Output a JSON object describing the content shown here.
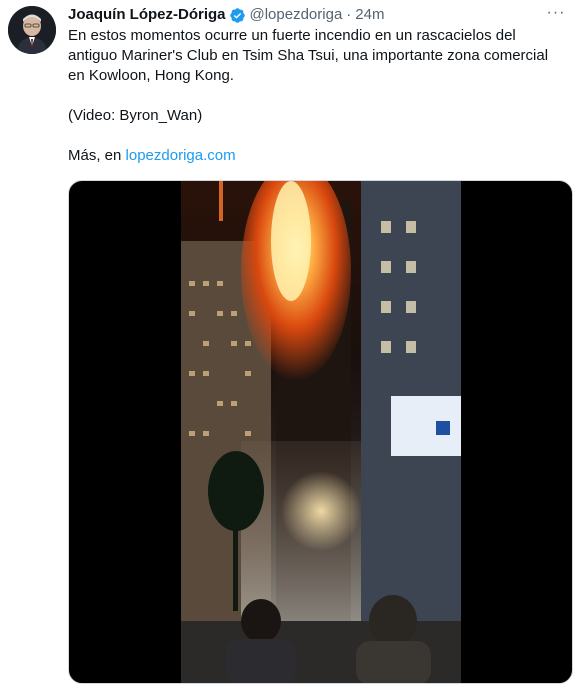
{
  "user": {
    "display_name": "Joaquín López-Dóriga",
    "handle": "@lopezdoriga",
    "separator": "·",
    "timestamp": "24m",
    "verified_icon": "verified-badge-icon",
    "avatar_icon": "avatar"
  },
  "menu": {
    "more_label": "···",
    "icon": "more-options-icon"
  },
  "tweet": {
    "text_line1": "En estos momentos ocurre un fuerte incendio en un rascacielos del antiguo Mariner's Club en Tsim Sha Tsui, una importante zona comercial en Kowloon, Hong Kong.",
    "credit": "(Video: Byron_Wan)",
    "more_prefix": "Más, en ",
    "more_link": "lopezdoriga.com"
  },
  "colors": {
    "link": "#1d9bf0",
    "secondary": "#536471",
    "primary": "#0f1419",
    "verified": "#1d9bf0"
  },
  "media": {
    "type": "video-thumbnail"
  }
}
